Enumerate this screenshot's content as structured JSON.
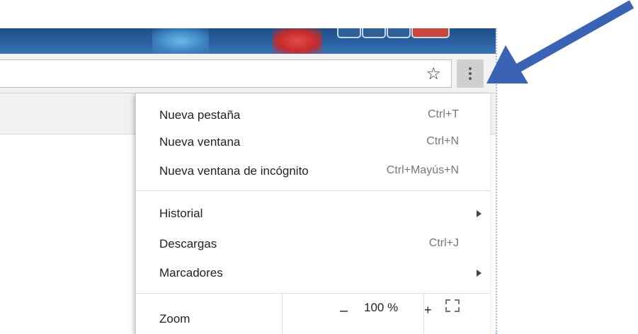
{
  "toolbar": {
    "bookmark_icon": "star-outline-icon",
    "menu_icon": "vertical-dots-icon"
  },
  "menu": {
    "items_group1": [
      {
        "label": "Nueva pestaña",
        "shortcut": "Ctrl+T"
      },
      {
        "label": "Nueva ventana",
        "shortcut": "Ctrl+N"
      },
      {
        "label": "Nueva ventana de incógnito",
        "shortcut": "Ctrl+Mayús+N"
      }
    ],
    "items_group2": [
      {
        "label": "Historial",
        "has_submenu": true
      },
      {
        "label": "Descargas",
        "shortcut": "Ctrl+J"
      },
      {
        "label": "Marcadores",
        "has_submenu": true
      }
    ],
    "zoom": {
      "label": "Zoom",
      "minus": "–",
      "value": "100 %",
      "plus": "+"
    }
  },
  "annotation": {
    "arrow_color": "#3a62b5",
    "arrow_target": "menu-button"
  }
}
